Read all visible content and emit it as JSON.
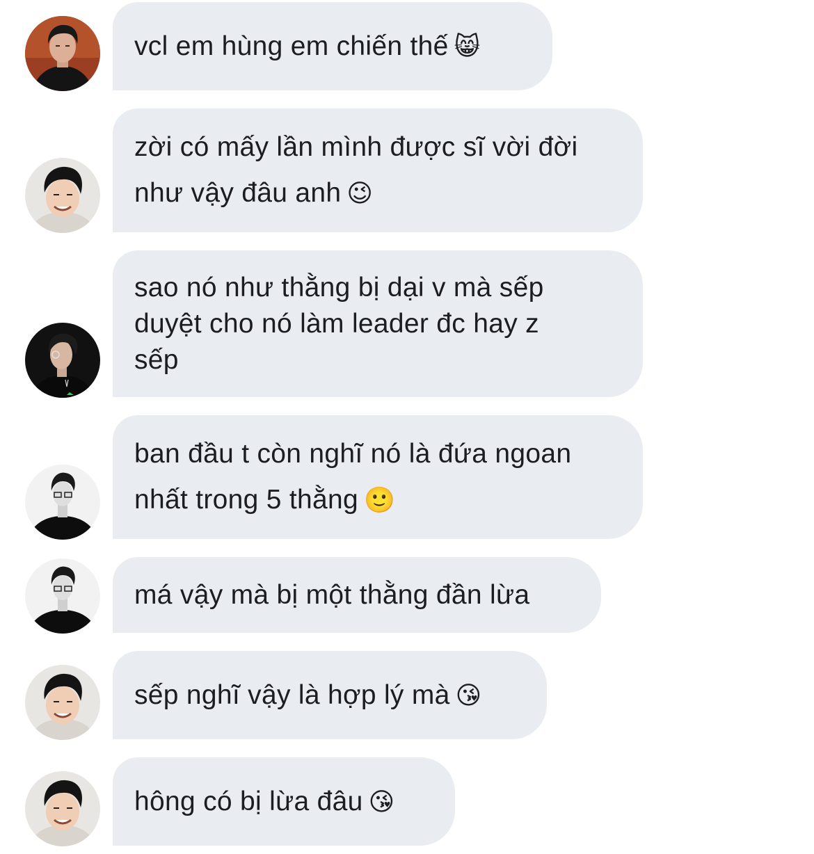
{
  "messages": [
    {
      "text": "vcl em hùng em chiến thế",
      "emoji": "😸",
      "avatar": "avatar-portrait-red-bg"
    },
    {
      "text": "zời có mấy lần mình được sĩ vời đời\nnhư vậy đâu anh",
      "emoji": "😉",
      "avatar": "avatar-smiling-man"
    },
    {
      "text": "sao nó như thằng bị dại v mà sếp\nduyệt cho nó làm leader đc hay z\nsếp",
      "emoji": "",
      "avatar": "avatar-side-profile"
    },
    {
      "text": "ban đầu t còn nghĩ nó là đứa ngoan\nnhất trong 5 thằng",
      "emoji": "🙂",
      "avatar": "avatar-glasses-bw"
    },
    {
      "text": "má vậy mà bị một thằng đần lừa",
      "emoji": "",
      "avatar": "avatar-glasses-bw"
    },
    {
      "text": "sếp nghĩ vậy là hợp lý mà",
      "emoji": "😘",
      "avatar": "avatar-smiling-man"
    },
    {
      "text": "hông có bị lừa đâu",
      "emoji": "😘",
      "avatar": "avatar-smiling-man"
    }
  ],
  "colors": {
    "bubble": "#e9ecf1",
    "text": "#1b1d21",
    "background": "#ffffff"
  }
}
